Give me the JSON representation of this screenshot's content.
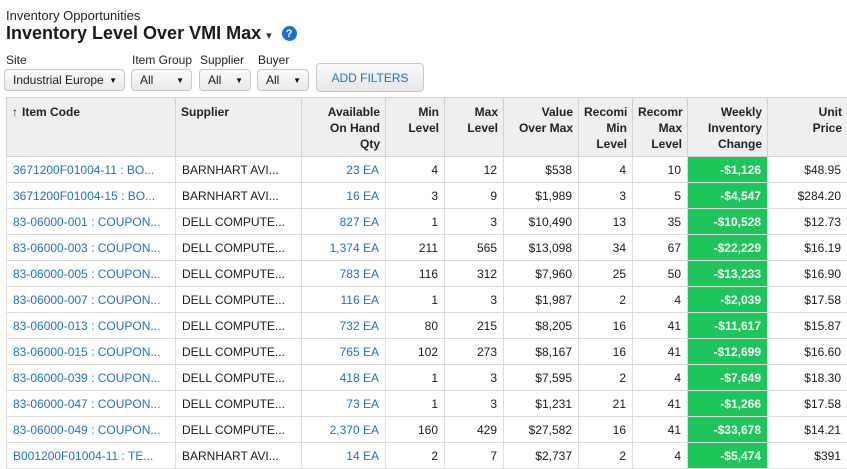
{
  "breadcrumb": "Inventory Opportunities",
  "title": "Inventory Level Over VMI Max",
  "title_caret": "▾",
  "help_icon": "?",
  "filters": [
    {
      "label": "Site",
      "value": "Industrial Europe"
    },
    {
      "label": "Item Group",
      "value": "All"
    },
    {
      "label": "Supplier",
      "value": "All"
    },
    {
      "label": "Buyer",
      "value": "All"
    }
  ],
  "add_filters_label": "ADD FILTERS",
  "colors": {
    "accent": "#1f6fd1",
    "positive_change_bg": "#1ec55a"
  },
  "table": {
    "sort_icon": "↑",
    "headers": {
      "item_code": "Item Code",
      "supplier": "Supplier",
      "available_l1": "Available",
      "available_l2": "On Hand",
      "available_l3": "Qty",
      "min_l1": "Min",
      "min_l2": "Level",
      "max_l1": "Max",
      "max_l2": "Level",
      "value_l1": "Value",
      "value_l2": "Over Max",
      "rmin_l1": "Recomi",
      "rmin_l2": "Min",
      "rmin_l3": "Level",
      "rmax_l1": "Recomr",
      "rmax_l2": "Max",
      "rmax_l3": "Level",
      "weekly_l1": "Weekly",
      "weekly_l2": "Inventory",
      "weekly_l3": "Change",
      "price_l1": "Unit",
      "price_l2": "Price"
    },
    "rows": [
      {
        "item": "3671200F01004-11 : BO...",
        "supplier": "BARNHART AVI...",
        "qty": "23 EA",
        "min": "4",
        "max": "12",
        "value": "$538",
        "rmin": "4",
        "rmax": "10",
        "change": "-$1,126",
        "price": "$48.95"
      },
      {
        "item": "3671200F01004-15 : BO...",
        "supplier": "BARNHART AVI...",
        "qty": "16 EA",
        "min": "3",
        "max": "9",
        "value": "$1,989",
        "rmin": "3",
        "rmax": "5",
        "change": "-$4,547",
        "price": "$284.20"
      },
      {
        "item": "83-06000-001 : COUPON...",
        "supplier": "DELL COMPUTE...",
        "qty": "827 EA",
        "min": "1",
        "max": "3",
        "value": "$10,490",
        "rmin": "13",
        "rmax": "35",
        "change": "-$10,528",
        "price": "$12.73"
      },
      {
        "item": "83-06000-003 : COUPON...",
        "supplier": "DELL COMPUTE...",
        "qty": "1,374 EA",
        "min": "211",
        "max": "565",
        "value": "$13,098",
        "rmin": "34",
        "rmax": "67",
        "change": "-$22,229",
        "price": "$16.19"
      },
      {
        "item": "83-06000-005 : COUPON...",
        "supplier": "DELL COMPUTE...",
        "qty": "783 EA",
        "min": "116",
        "max": "312",
        "value": "$7,960",
        "rmin": "25",
        "rmax": "50",
        "change": "-$13,233",
        "price": "$16.90"
      },
      {
        "item": "83-06000-007 : COUPON...",
        "supplier": "DELL COMPUTE...",
        "qty": "116 EA",
        "min": "1",
        "max": "3",
        "value": "$1,987",
        "rmin": "2",
        "rmax": "4",
        "change": "-$2,039",
        "price": "$17.58"
      },
      {
        "item": "83-06000-013 : COUPON...",
        "supplier": "DELL COMPUTE...",
        "qty": "732 EA",
        "min": "80",
        "max": "215",
        "value": "$8,205",
        "rmin": "16",
        "rmax": "41",
        "change": "-$11,617",
        "price": "$15.87"
      },
      {
        "item": "83-06000-015 : COUPON...",
        "supplier": "DELL COMPUTE...",
        "qty": "765 EA",
        "min": "102",
        "max": "273",
        "value": "$8,167",
        "rmin": "16",
        "rmax": "41",
        "change": "-$12,699",
        "price": "$16.60"
      },
      {
        "item": "83-06000-039 : COUPON...",
        "supplier": "DELL COMPUTE...",
        "qty": "418 EA",
        "min": "1",
        "max": "3",
        "value": "$7,595",
        "rmin": "2",
        "rmax": "4",
        "change": "-$7,649",
        "price": "$18.30"
      },
      {
        "item": "83-06000-047 : COUPON...",
        "supplier": "DELL COMPUTE...",
        "qty": "73 EA",
        "min": "1",
        "max": "3",
        "value": "$1,231",
        "rmin": "21",
        "rmax": "41",
        "change": "-$1,266",
        "price": "$17.58"
      },
      {
        "item": "83-06000-049 : COUPON...",
        "supplier": "DELL COMPUTE...",
        "qty": "2,370 EA",
        "min": "160",
        "max": "429",
        "value": "$27,582",
        "rmin": "16",
        "rmax": "41",
        "change": "-$33,678",
        "price": "$14.21"
      },
      {
        "item": "B001200F01004-11 : TE...",
        "supplier": "BARNHART AVI...",
        "qty": "14 EA",
        "min": "2",
        "max": "7",
        "value": "$2,737",
        "rmin": "2",
        "rmax": "4",
        "change": "-$5,474",
        "price": "$391"
      }
    ]
  }
}
